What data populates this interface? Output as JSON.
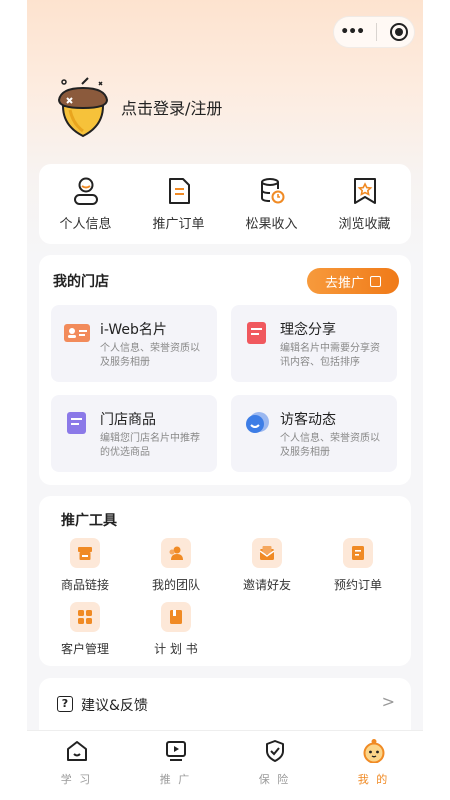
{
  "header": {
    "login_text": "点击登录/注册"
  },
  "quick_links": [
    {
      "label": "个人信息",
      "icon": "person-icon"
    },
    {
      "label": "推广订单",
      "icon": "document-icon"
    },
    {
      "label": "松果收入",
      "icon": "income-database-icon"
    },
    {
      "label": "浏览收藏",
      "icon": "bookmark-icon"
    }
  ],
  "store": {
    "title": "我的门店",
    "promote_label": "去推广",
    "tiles": [
      {
        "title": "i-Web名片",
        "desc": "个人信息、荣誉资质以及服务相册",
        "icon": "business-card-icon"
      },
      {
        "title": "理念分享",
        "desc": "编辑名片中需要分享资讯内容、包括排序",
        "icon": "share-doc-icon"
      },
      {
        "title": "门店商品",
        "desc": "编辑您门店名片中推荐的优选商品",
        "icon": "store-goods-icon"
      },
      {
        "title": "访客动态",
        "desc": "个人信息、荣誉资质以及服务相册",
        "icon": "visitor-icon"
      }
    ]
  },
  "tools": {
    "title": "推广工具",
    "items": [
      {
        "label": "商品链接",
        "icon": "product-link-icon"
      },
      {
        "label": "我的团队",
        "icon": "team-icon"
      },
      {
        "label": "邀请好友",
        "icon": "invite-envelope-icon"
      },
      {
        "label": "预约订单",
        "icon": "appointment-icon"
      },
      {
        "label": "客户管理",
        "icon": "customer-grid-icon"
      },
      {
        "label": "计 划 书",
        "icon": "plan-book-icon"
      }
    ]
  },
  "feedback": {
    "label": "建议&反馈"
  },
  "tabbar": [
    {
      "label": "学 习",
      "icon": "home-icon"
    },
    {
      "label": "推 广",
      "icon": "play-icon"
    },
    {
      "label": "保 险",
      "icon": "shield-icon"
    },
    {
      "label": "我 的",
      "icon": "profile-mascot-icon",
      "active": true
    }
  ],
  "colors": {
    "accent": "#f08a24",
    "tile_bg": "#f4f4f9",
    "tool_icon_bg": "#fde8d8"
  }
}
